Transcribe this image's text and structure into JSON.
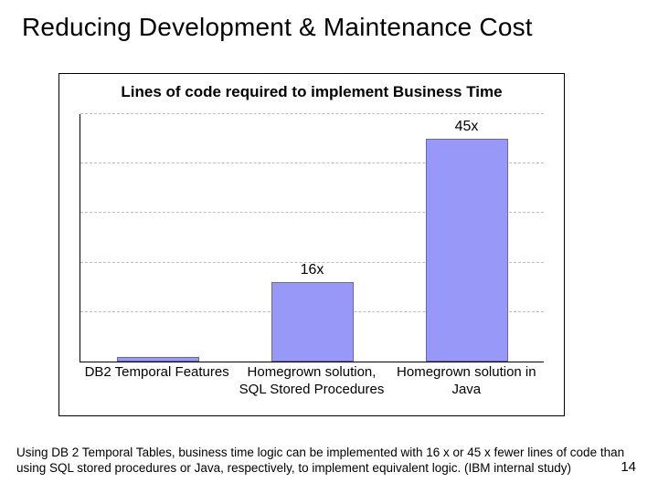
{
  "slide": {
    "title": "Reducing Development & Maintenance Cost",
    "page_number": "14",
    "caption": "Using DB 2 Temporal Tables, business time logic can be implemented with 16 x or 45 x fewer lines of code than using SQL stored procedures or Java, respectively, to implement equivalent logic. (IBM internal study)"
  },
  "chart_data": {
    "type": "bar",
    "title": "Lines of code required to implement Business Time",
    "categories": [
      "DB2 Temporal Features",
      "Homegrown solution, SQL Stored Procedures",
      "Homegrown solution in Java"
    ],
    "values": [
      1,
      16,
      45
    ],
    "value_labels": [
      "",
      "16x",
      "45x"
    ],
    "ylim": [
      0,
      50
    ],
    "gridlines": [
      10,
      20,
      30,
      40,
      50
    ],
    "xlabel": "",
    "ylabel": "",
    "colors": {
      "bar_fill": "#9898f8",
      "bar_border": "#6464c8",
      "grid": "#bdbdbd"
    }
  }
}
